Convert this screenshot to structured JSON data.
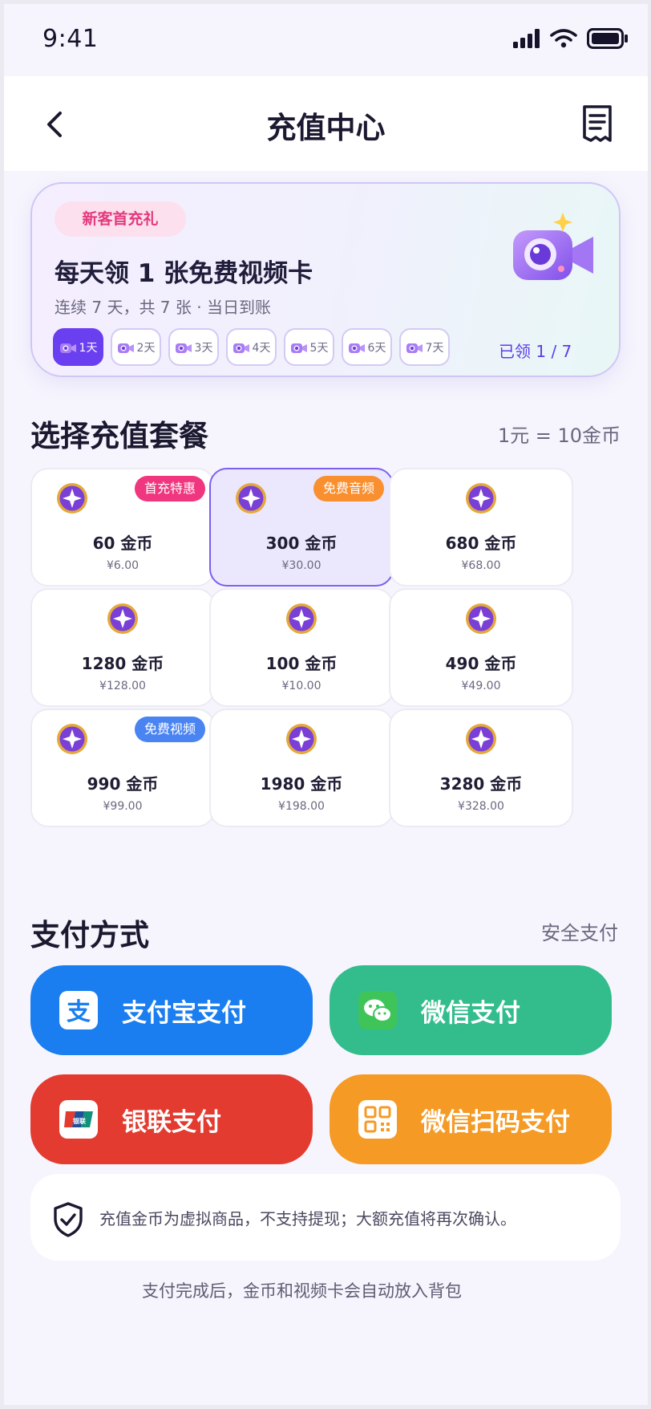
{
  "status_bar": {
    "time": "9:41"
  },
  "nav": {
    "title": "充值中心"
  },
  "banner": {
    "tag": "新客首充礼",
    "headline": "每天领 1 张免费视频卡",
    "subline": "连续 7 天，共 7 张 · 当日到账",
    "days": [
      "1天",
      "2天",
      "3天",
      "4天",
      "5天",
      "6天",
      "7天"
    ],
    "active_day_index": 0,
    "claimed": "已领 1 / 7"
  },
  "packages": {
    "title": "选择充值套餐",
    "rate": "1元 = 10金币",
    "items": [
      {
        "amount": "60 金币",
        "price": "¥6.00",
        "badge": "首充特惠",
        "badge_color": "#f0367f",
        "selected": false
      },
      {
        "amount": "300 金币",
        "price": "¥30.00",
        "badge": "免费音频",
        "badge_color": "#f98f2e",
        "selected": true
      },
      {
        "amount": "680 金币",
        "price": "¥68.00",
        "badge": "",
        "badge_color": "",
        "selected": false
      },
      {
        "amount": "1280 金币",
        "price": "¥128.00",
        "badge": "",
        "badge_color": "",
        "selected": false
      },
      {
        "amount": "100 金币",
        "price": "¥10.00",
        "badge": "",
        "badge_color": "",
        "selected": false
      },
      {
        "amount": "490 金币",
        "price": "¥49.00",
        "badge": "",
        "badge_color": "",
        "selected": false
      },
      {
        "amount": "990 金币",
        "price": "¥99.00",
        "badge": "免费视频",
        "badge_color": "#4a84f2",
        "selected": false
      },
      {
        "amount": "1980 金币",
        "price": "¥198.00",
        "badge": "",
        "badge_color": "",
        "selected": false
      },
      {
        "amount": "3280 金币",
        "price": "¥328.00",
        "badge": "",
        "badge_color": "",
        "selected": false
      }
    ]
  },
  "payment": {
    "title": "支付方式",
    "aside": "安全支付",
    "methods": [
      {
        "label": "支付宝支付",
        "color": "#1a7ef0",
        "icon": "alipay-icon"
      },
      {
        "label": "微信支付",
        "color": "#33bd8c",
        "icon": "wechat-icon"
      },
      {
        "label": "银联支付",
        "color": "#e33b30",
        "icon": "unionpay-icon"
      },
      {
        "label": "微信扫码支付",
        "color": "#f59a24",
        "icon": "qr-code-icon"
      }
    ]
  },
  "notice": {
    "text": "充值金币为虚拟商品，不支持提现；大额充值将再次确认。"
  },
  "footer": {
    "text": "支付完成后，金币和视频卡会自动放入背包"
  }
}
